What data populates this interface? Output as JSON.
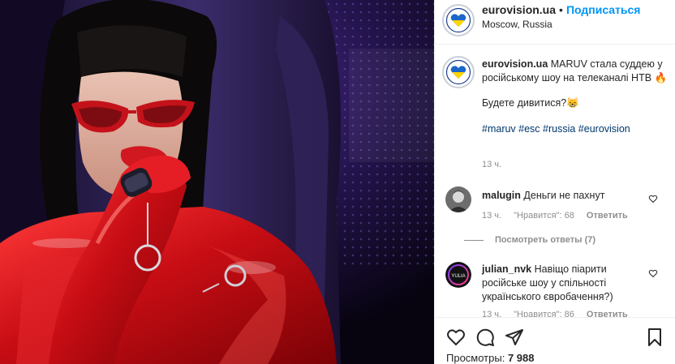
{
  "header": {
    "username": "eurovision.ua",
    "separator": "•",
    "follow_label": "Подписаться",
    "location": "Moscow, Russia"
  },
  "caption": {
    "username": "eurovision.ua",
    "text": "MARUV стала суддею у російському шоу на телеканалі НТВ 🔥",
    "line2": "Будете дивитися?😸",
    "hashtags": "#maruv #esc #russia #eurovision",
    "time": "13 ч."
  },
  "comments": [
    {
      "username": "malugin",
      "text": "Деньги не пахнут",
      "time": "13 ч.",
      "likes": "\"Нравится\": 68",
      "reply_label": "Ответить",
      "view_replies": "Посмотреть ответы (7)"
    },
    {
      "username": "julian_nvk",
      "text": "Навіщо піарити російське шоу у спільності українського євробачення?)",
      "time": "13 ч.",
      "likes": "\"Нравится\": 86",
      "reply_label": "Ответить",
      "avatar_text": "YULIA"
    }
  ],
  "actions": {
    "views_label": "Просмотры:",
    "views_count": "7 988",
    "icons": [
      "heart-icon",
      "comment-icon",
      "share-icon",
      "bookmark-icon"
    ]
  },
  "colors": {
    "accent": "#0095f6",
    "hashtag": "#00376b",
    "muted": "#8e8e8e",
    "text": "#262626",
    "costume_red": "#d4141a"
  }
}
